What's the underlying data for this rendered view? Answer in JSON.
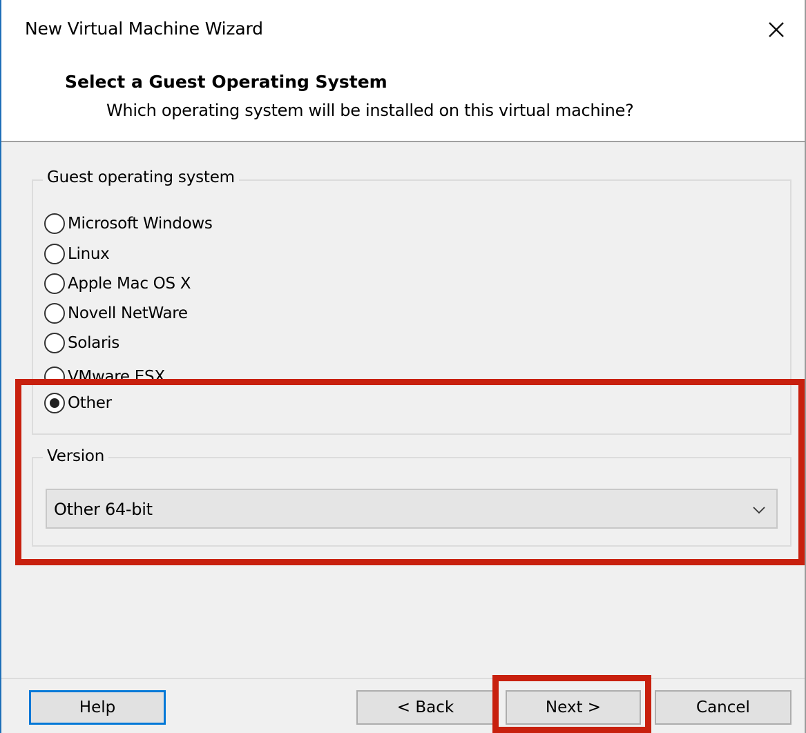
{
  "window": {
    "title": "New Virtual Machine Wizard"
  },
  "header": {
    "title": "Select a Guest Operating System",
    "subtitle": "Which operating system will be installed on this virtual machine?"
  },
  "guest_os": {
    "legend": "Guest operating system",
    "options": [
      {
        "label": "Microsoft Windows",
        "checked": false
      },
      {
        "label": "Linux",
        "checked": false
      },
      {
        "label": "Apple Mac OS X",
        "checked": false
      },
      {
        "label": "Novell NetWare",
        "checked": false
      },
      {
        "label": "Solaris",
        "checked": false
      },
      {
        "label": "VMware ESX",
        "checked": false
      },
      {
        "label": "Other",
        "checked": true
      }
    ]
  },
  "version": {
    "legend": "Version",
    "selected": "Other 64-bit"
  },
  "buttons": {
    "help": "Help",
    "back": "< Back",
    "next": "Next >",
    "cancel": "Cancel"
  },
  "colors": {
    "highlight": "#c8200e",
    "focus_border": "#0078d7",
    "title_border": "#1e6fb8"
  },
  "icons": {
    "close": "close-icon",
    "dropdown": "chevron-down-icon"
  }
}
